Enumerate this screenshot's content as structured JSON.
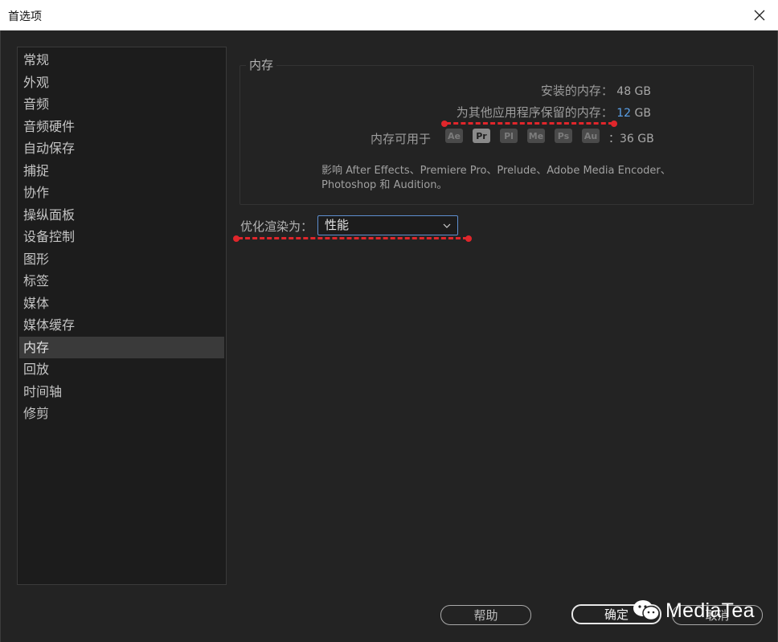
{
  "window": {
    "title": "首选项"
  },
  "sidebar": {
    "items": [
      {
        "label": "常规"
      },
      {
        "label": "外观"
      },
      {
        "label": "音频"
      },
      {
        "label": "音频硬件"
      },
      {
        "label": "自动保存"
      },
      {
        "label": "捕捉"
      },
      {
        "label": "协作"
      },
      {
        "label": "操纵面板"
      },
      {
        "label": "设备控制"
      },
      {
        "label": "图形"
      },
      {
        "label": "标签"
      },
      {
        "label": "媒体"
      },
      {
        "label": "媒体缓存"
      },
      {
        "label": "内存"
      },
      {
        "label": "回放"
      },
      {
        "label": "时间轴"
      },
      {
        "label": "修剪"
      }
    ],
    "selected": "内存"
  },
  "memory": {
    "group_title": "内存",
    "installed_label": "安装的内存：",
    "installed_value": "48 GB",
    "reserved_label": "为其他应用程序保留的内存：",
    "reserved_value": "12",
    "reserved_unit": "GB",
    "available_label": "内存可用于",
    "available_value": "：36 GB",
    "apps": [
      {
        "code": "Ae",
        "active": false
      },
      {
        "code": "Pr",
        "active": true
      },
      {
        "code": "Pl",
        "active": false
      },
      {
        "code": "Me",
        "active": false
      },
      {
        "code": "Ps",
        "active": false
      },
      {
        "code": "Au",
        "active": false
      }
    ],
    "note": "影响 After Effects、Premiere Pro、Prelude、Adobe Media Encoder、Photoshop 和 Audition。"
  },
  "render": {
    "label": "优化渲染为：",
    "value": "性能"
  },
  "buttons": {
    "help": "帮助",
    "ok": "确定",
    "cancel": "取消"
  },
  "watermark": {
    "text": "MediaTea"
  },
  "colors": {
    "annotation": "#e0262b",
    "accent": "#5aa0e8"
  }
}
